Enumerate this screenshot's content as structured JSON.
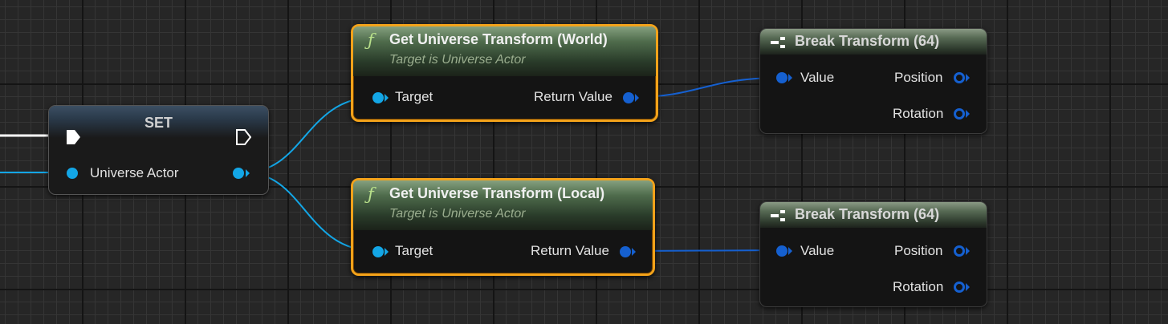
{
  "set_node": {
    "title": "SET",
    "input_label": "Universe Actor"
  },
  "world_node": {
    "title": "Get Universe Transform (World)",
    "subtitle": "Target is Universe Actor",
    "target_label": "Target",
    "return_label": "Return Value"
  },
  "local_node": {
    "title": "Get Universe Transform (Local)",
    "subtitle": "Target is Universe Actor",
    "target_label": "Target",
    "return_label": "Return Value"
  },
  "break_node_1": {
    "title": "Break Transform (64)",
    "value_label": "Value",
    "position_label": "Position",
    "rotation_label": "Rotation"
  },
  "break_node_2": {
    "title": "Break Transform (64)",
    "value_label": "Value",
    "position_label": "Position",
    "rotation_label": "Rotation"
  },
  "colors": {
    "object_pin": "#13a6e6",
    "struct_pin": "#1560d0",
    "pure_function_border": "#f2a21a",
    "exec_wire": "#ffffff"
  },
  "icons": {
    "function": "function-icon",
    "break": "break-struct-icon",
    "exec": "exec-pin-icon"
  }
}
